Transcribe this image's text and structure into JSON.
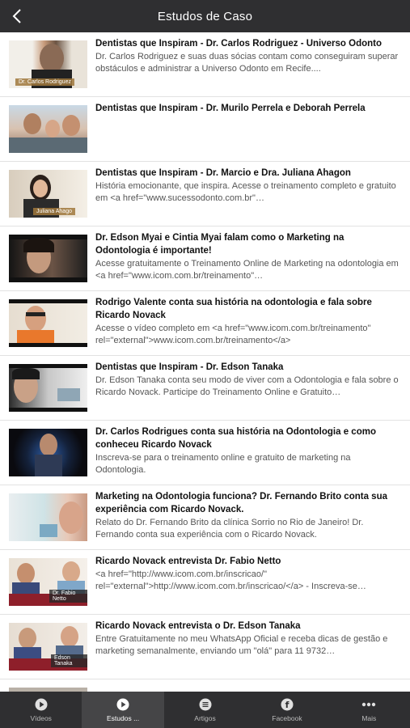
{
  "header": {
    "title": "Estudos de Caso",
    "back_icon": "chevron-left-icon"
  },
  "items": [
    {
      "title": "Dentistas que Inspiram - Dr. Carlos Rodriguez - Universo Odonto",
      "desc": "Dr. Carlos Rodriguez e suas duas sócias contam como conseguiram superar obstáculos e administrar a Universo Odonto em Recife....",
      "thumb_caption": "Dr. Carlos Rodriguez"
    },
    {
      "title": "Dentistas que Inspiram - Dr. Murilo Perrela e Deborah Perrela",
      "desc": "",
      "thumb_caption": ""
    },
    {
      "title": "Dentistas que Inspiram - Dr. Marcio e Dra. Juliana Ahagon",
      "desc": "História emocionante, que inspira. Acesse o treinamento completo e gratuito em <a href=\"www.sucessodonto.com.br\"…",
      "thumb_caption": "Juliana Ahago"
    },
    {
      "title": "Dr. Edson Myai e Cintia Myai falam como o Marketing na Odontologia é importante!",
      "desc": "Acesse gratuitamente o Treinamento Online de Marketing na odontologia em <a href=\"www.icom.com.br/treinamento\"…",
      "thumb_caption": ""
    },
    {
      "title": "Rodrigo Valente conta sua história na odontologia e fala sobre Ricardo Novack",
      "desc": "Acesse o vídeo completo em <a href=\"www.icom.com.br/treinamento\" rel=\"external\">www.icom.com.br/treinamento</a>",
      "thumb_caption": ""
    },
    {
      "title": "Dentistas que Inspiram - Dr. Edson Tanaka",
      "desc": "Dr. Edson Tanaka conta seu modo de viver com a Odontologia e fala sobre o Ricardo Novack. Participe do Treinamento Online e Gratuito…",
      "thumb_caption": ""
    },
    {
      "title": "Dr. Carlos Rodrigues conta sua história na Odontologia e como conheceu Ricardo Novack",
      "desc": "Inscreva-se para o treinamento online e gratuito de marketing na Odontologia.",
      "thumb_caption": ""
    },
    {
      "title": "Marketing na Odontologia funciona? Dr. Fernando Brito conta sua experiência com Ricardo Novack.",
      "desc": "Relato do Dr. Fernando Brito da clínica Sorrio no Rio de Janeiro! Dr. Fernando conta sua experiência com o Ricardo Novack.",
      "thumb_caption": ""
    },
    {
      "title": "Ricardo Novack entrevista Dr. Fabio Netto",
      "desc": "<a href=\"http://www.icom.com.br/inscricao/\" rel=\"external\">http://www.icom.com.br/inscricao/</a> - Inscreva-se…",
      "thumb_caption": "Dr. Fabio Netto"
    },
    {
      "title": "Ricardo Novack entrevista o Dr. Edson Tanaka",
      "desc": "Entre Gratuitamente no meu WhatsApp Oficial e receba dicas de gestão e marketing semanalmente, enviando um \"olá\" para 11 9732…",
      "thumb_caption": "Edson Tanaka"
    }
  ],
  "tabs": [
    {
      "label": "Vídeos",
      "icon": "play-circle-icon"
    },
    {
      "label": "Estudos ...",
      "icon": "play-circle-icon"
    },
    {
      "label": "Artigos",
      "icon": "list-icon"
    },
    {
      "label": "Facebook",
      "icon": "facebook-icon"
    },
    {
      "label": "Mais",
      "icon": "more-dots-icon"
    }
  ],
  "colors": {
    "bar": "#2f2f31",
    "active_tab": "#454547"
  }
}
